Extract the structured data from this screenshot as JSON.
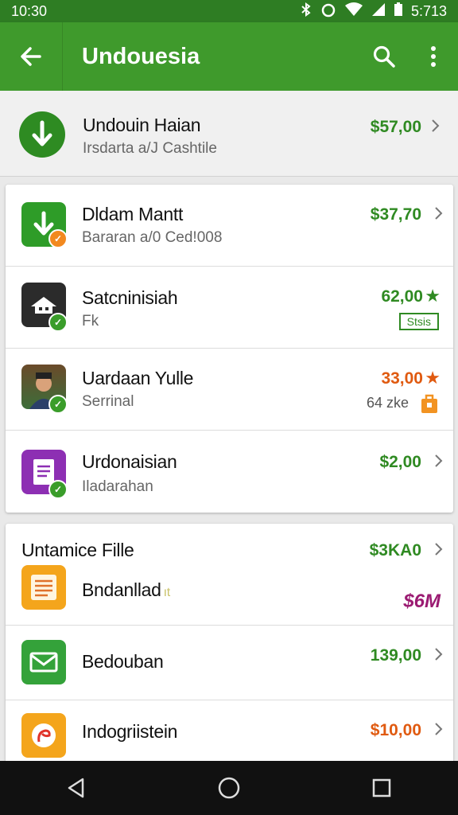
{
  "status": {
    "time": "10:30",
    "clock": "5:713"
  },
  "appbar": {
    "title": "Undouesia"
  },
  "top_item": {
    "title": "Undouin Haian",
    "subtitle": "Irsdarta a/J Cashtile",
    "price": "$57,00"
  },
  "list1": [
    {
      "title": "Dldam Mantt",
      "subtitle": "Bararan a/0 Ced!008",
      "price": "$37,70"
    },
    {
      "title": "Satcninisiah",
      "subtitle": "Fk",
      "price": "62,00",
      "tag": "Stsis"
    },
    {
      "title": "Uardaan Yulle",
      "subtitle": "Serrinal",
      "price": "33,00",
      "extra": "64 zke"
    },
    {
      "title": "Urdonaisian",
      "subtitle": "Iladarahan",
      "price": "$2,00"
    }
  ],
  "section2": {
    "header": "Untamice Fille",
    "header_price": "$3KA0",
    "items": [
      {
        "title": "Bndanllad",
        "title_mark": "ıt",
        "price": "$6M"
      },
      {
        "title": "Bedouban",
        "price": "139,00"
      },
      {
        "title": "Indogriistein",
        "price": "$10,00"
      }
    ]
  },
  "colors": {
    "appbar": "#3f9a2c",
    "status": "#2e7d23",
    "price_green": "#2f8a22",
    "price_orange": "#e05a10",
    "price_purple": "#9b1b72"
  }
}
